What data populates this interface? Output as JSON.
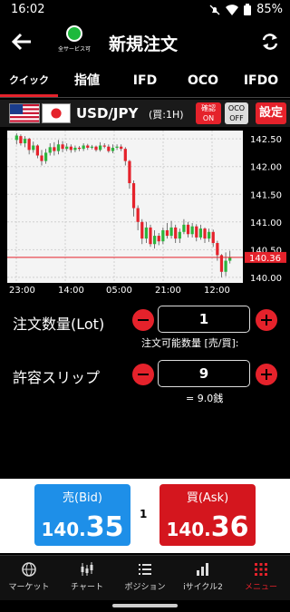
{
  "status": {
    "time": "16:02",
    "battery": "85%"
  },
  "header": {
    "service_label": "全サービス可",
    "title": "新規注文"
  },
  "tabs": [
    "クイック",
    "指値",
    "IFD",
    "OCO",
    "IFDO"
  ],
  "pair": {
    "symbol": "USD/JPY",
    "timeframe": "(買:1H)",
    "confirm_label": "確認",
    "confirm_state": "ON",
    "oco_label": "OCO",
    "oco_state": "OFF",
    "settings_label": "設定"
  },
  "chart_data": {
    "type": "candlestick",
    "y_ticks": [
      "142.50",
      "142.00",
      "141.50",
      "141.00",
      "140.50",
      "140.00"
    ],
    "current_price_label": "140.36",
    "x_ticks": [
      "23:00",
      "14:00",
      "05:00",
      "21:00",
      "12:00"
    ],
    "ylim": [
      139.9,
      142.65
    ],
    "current_price": 140.36,
    "up_color": "#2bb53c",
    "down_color": "#e5222b",
    "candles": [
      {
        "o": 142.48,
        "c": 142.56,
        "h": 142.6,
        "l": 142.4
      },
      {
        "o": 142.55,
        "c": 142.42,
        "h": 142.58,
        "l": 142.38
      },
      {
        "o": 142.42,
        "c": 142.5,
        "h": 142.55,
        "l": 142.35
      },
      {
        "o": 142.5,
        "c": 142.3,
        "h": 142.52,
        "l": 142.22
      },
      {
        "o": 142.3,
        "c": 142.38,
        "h": 142.45,
        "l": 142.25
      },
      {
        "o": 142.38,
        "c": 142.2,
        "h": 142.4,
        "l": 142.15
      },
      {
        "o": 142.2,
        "c": 142.1,
        "h": 142.3,
        "l": 142.02
      },
      {
        "o": 142.1,
        "c": 142.25,
        "h": 142.32,
        "l": 142.05
      },
      {
        "o": 142.25,
        "c": 142.35,
        "h": 142.42,
        "l": 142.2
      },
      {
        "o": 142.35,
        "c": 142.28,
        "h": 142.44,
        "l": 142.2
      },
      {
        "o": 142.28,
        "c": 142.4,
        "h": 142.48,
        "l": 142.22
      },
      {
        "o": 142.4,
        "c": 142.32,
        "h": 142.46,
        "l": 142.26
      },
      {
        "o": 142.32,
        "c": 142.36,
        "h": 142.42,
        "l": 142.28
      },
      {
        "o": 142.36,
        "c": 142.3,
        "h": 142.4,
        "l": 142.25
      },
      {
        "o": 142.3,
        "c": 142.34,
        "h": 142.38,
        "l": 142.26
      },
      {
        "o": 142.34,
        "c": 142.32,
        "h": 142.37,
        "l": 142.28
      },
      {
        "o": 142.32,
        "c": 142.38,
        "h": 142.42,
        "l": 142.28
      },
      {
        "o": 142.38,
        "c": 142.34,
        "h": 142.41,
        "l": 142.3
      },
      {
        "o": 142.34,
        "c": 142.36,
        "h": 142.39,
        "l": 142.31
      },
      {
        "o": 142.36,
        "c": 142.3,
        "h": 142.38,
        "l": 142.27
      },
      {
        "o": 142.3,
        "c": 142.38,
        "h": 142.44,
        "l": 142.27
      },
      {
        "o": 142.38,
        "c": 142.36,
        "h": 142.42,
        "l": 142.33
      },
      {
        "o": 142.36,
        "c": 142.28,
        "h": 142.4,
        "l": 142.25
      },
      {
        "o": 142.28,
        "c": 142.34,
        "h": 142.4,
        "l": 142.24
      },
      {
        "o": 142.34,
        "c": 142.36,
        "h": 142.4,
        "l": 142.3
      },
      {
        "o": 142.36,
        "c": 142.32,
        "h": 142.4,
        "l": 142.28
      },
      {
        "o": 142.32,
        "c": 142.1,
        "h": 142.35,
        "l": 142.02
      },
      {
        "o": 142.1,
        "c": 141.7,
        "h": 142.12,
        "l": 141.6
      },
      {
        "o": 141.7,
        "c": 141.25,
        "h": 141.75,
        "l": 141.1
      },
      {
        "o": 141.25,
        "c": 141.0,
        "h": 141.3,
        "l": 140.85
      },
      {
        "o": 141.0,
        "c": 140.7,
        "h": 141.05,
        "l": 140.6
      },
      {
        "o": 140.7,
        "c": 140.9,
        "h": 141.0,
        "l": 140.62
      },
      {
        "o": 140.9,
        "c": 140.6,
        "h": 140.95,
        "l": 140.55
      },
      {
        "o": 140.6,
        "c": 140.75,
        "h": 140.85,
        "l": 140.52
      },
      {
        "o": 140.75,
        "c": 140.65,
        "h": 140.8,
        "l": 140.58
      },
      {
        "o": 140.65,
        "c": 140.85,
        "h": 140.9,
        "l": 140.6
      },
      {
        "o": 140.85,
        "c": 140.75,
        "h": 140.98,
        "l": 140.7
      },
      {
        "o": 140.75,
        "c": 140.9,
        "h": 141.02,
        "l": 140.7
      },
      {
        "o": 140.9,
        "c": 140.7,
        "h": 140.95,
        "l": 140.62
      },
      {
        "o": 140.7,
        "c": 140.82,
        "h": 140.88,
        "l": 140.62
      },
      {
        "o": 140.82,
        "c": 140.95,
        "h": 141.05,
        "l": 140.78
      },
      {
        "o": 140.95,
        "c": 140.78,
        "h": 141.0,
        "l": 140.72
      },
      {
        "o": 140.78,
        "c": 140.92,
        "h": 140.98,
        "l": 140.72
      },
      {
        "o": 140.92,
        "c": 140.72,
        "h": 140.96,
        "l": 140.65
      },
      {
        "o": 140.72,
        "c": 140.88,
        "h": 140.95,
        "l": 140.68
      },
      {
        "o": 140.88,
        "c": 140.7,
        "h": 140.9,
        "l": 140.62
      },
      {
        "o": 140.7,
        "c": 140.82,
        "h": 140.88,
        "l": 140.64
      },
      {
        "o": 140.82,
        "c": 140.62,
        "h": 140.86,
        "l": 140.55
      },
      {
        "o": 140.62,
        "c": 140.4,
        "h": 140.66,
        "l": 140.3
      },
      {
        "o": 140.4,
        "c": 140.1,
        "h": 140.42,
        "l": 140.0
      },
      {
        "o": 140.1,
        "c": 140.3,
        "h": 140.45,
        "l": 140.02
      },
      {
        "o": 140.3,
        "c": 140.36,
        "h": 140.48,
        "l": 140.25
      }
    ]
  },
  "lot": {
    "label": "注文数量(Lot)",
    "value": "1",
    "available_label": "注文可能数量 [売/買]:"
  },
  "slip": {
    "label": "許容スリップ",
    "value": "9",
    "note": "= 9.0銭"
  },
  "bid": {
    "label": "売(Bid)",
    "price_main": "140.",
    "price_big": "35"
  },
  "spread": "1",
  "ask": {
    "label": "買(Ask)",
    "price_main": "140.",
    "price_big": "36"
  },
  "nav": [
    {
      "label": "マーケット",
      "icon": "globe-icon"
    },
    {
      "label": "チャート",
      "icon": "candle-icon"
    },
    {
      "label": "ポジション",
      "icon": "list-icon"
    },
    {
      "label": "iサイクル2",
      "icon": "bar-chart-icon"
    },
    {
      "label": "メニュー",
      "icon": "grid-icon"
    }
  ]
}
